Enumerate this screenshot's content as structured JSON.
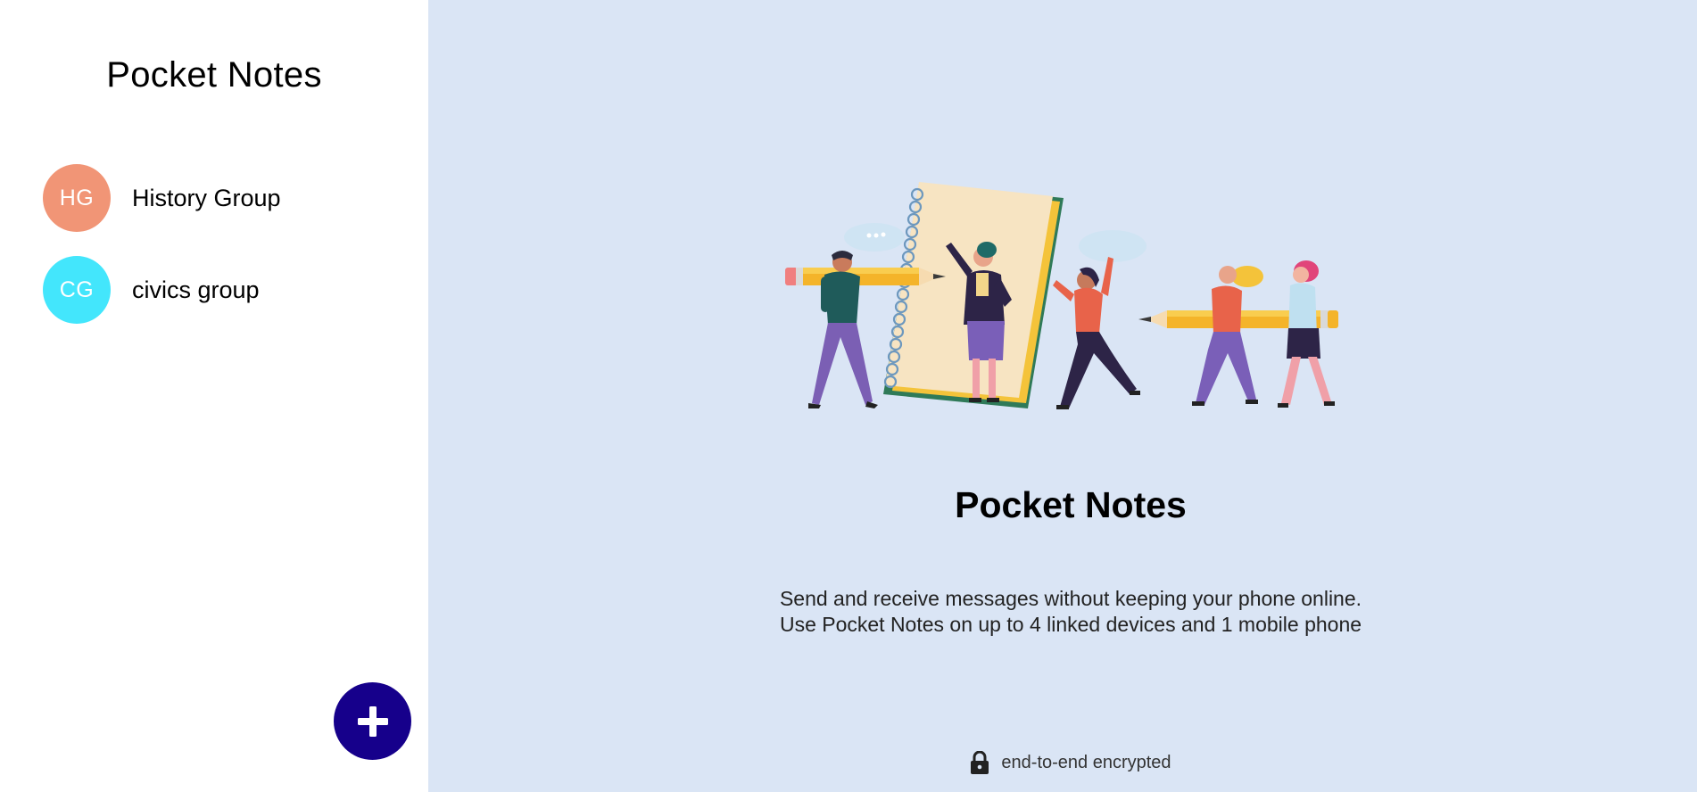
{
  "sidebar": {
    "title": "Pocket Notes",
    "groups": [
      {
        "initials": "HG",
        "name": "History Group",
        "color": "#f19576"
      },
      {
        "initials": "CG",
        "name": "civics group",
        "color": "#43e6fc"
      }
    ],
    "add_button": {
      "icon": "plus-icon",
      "color": "#16008b"
    }
  },
  "main": {
    "title": "Pocket Notes",
    "description_line1": "Send and receive messages without keeping your phone online.",
    "description_line2": "Use Pocket Notes on up to 4 linked devices and 1 mobile phone",
    "footer_text": "end-to-end encrypted",
    "footer_icon": "lock-icon",
    "background": "#dae5f5"
  }
}
